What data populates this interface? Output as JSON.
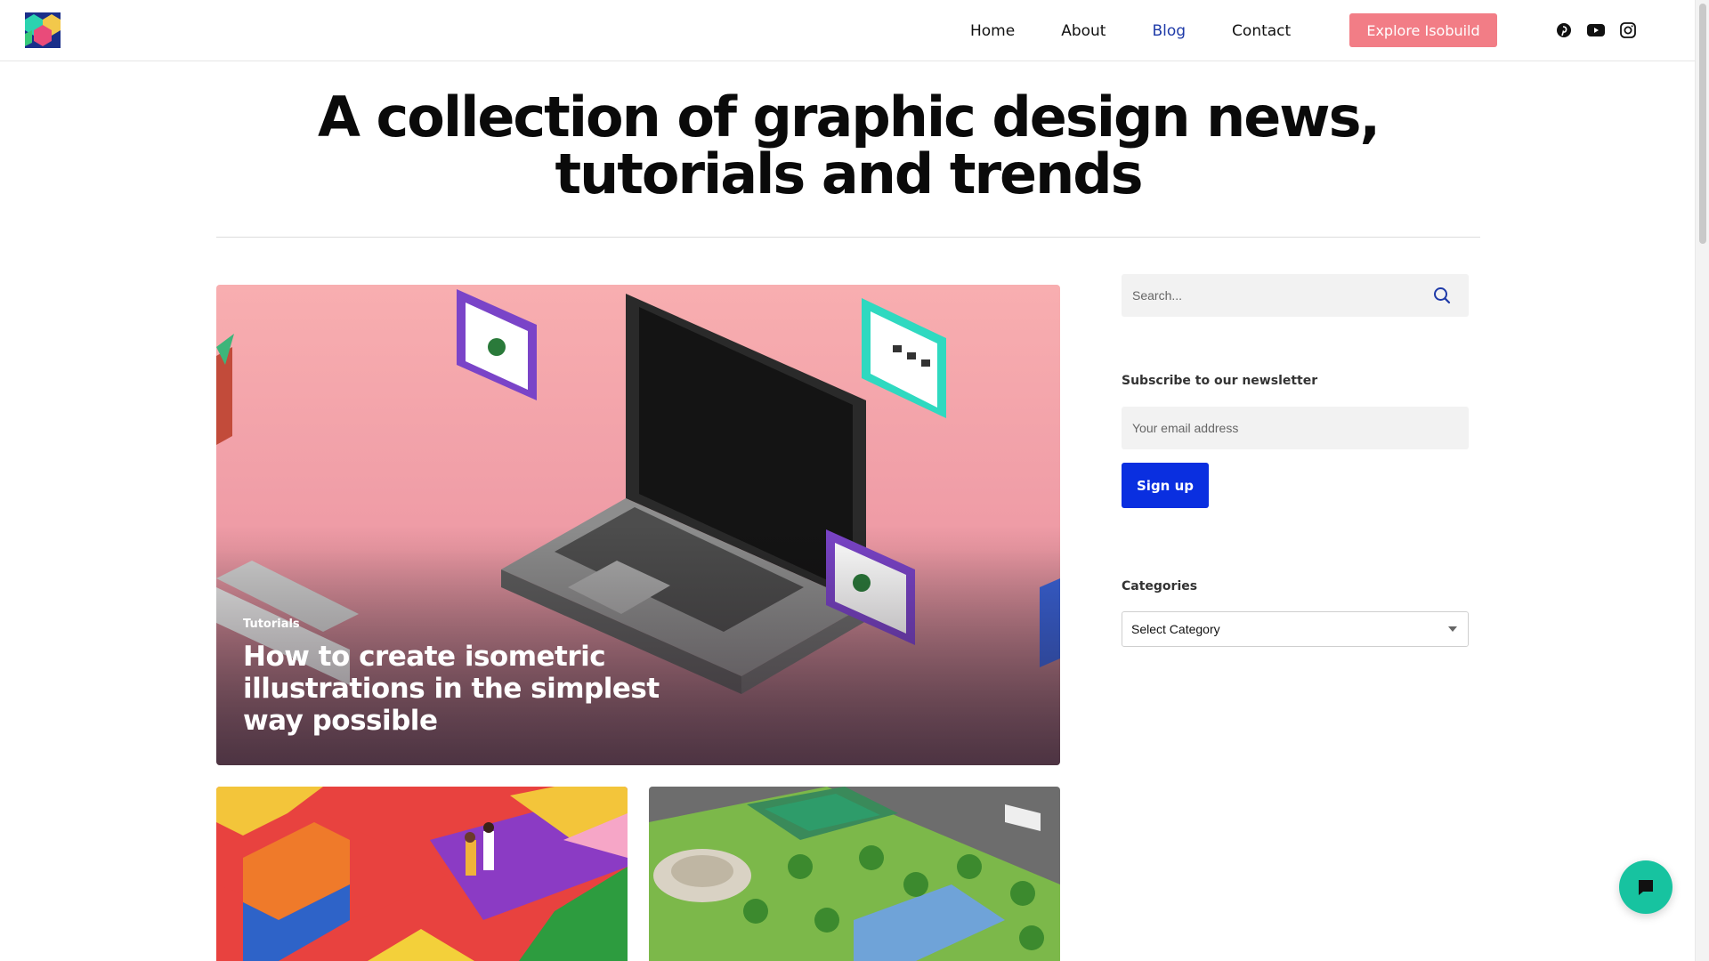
{
  "nav": {
    "items": [
      {
        "label": "Home",
        "active": false
      },
      {
        "label": "About",
        "active": false
      },
      {
        "label": "Blog",
        "active": true
      },
      {
        "label": "Contact",
        "active": false
      }
    ],
    "cta_label": "Explore Isobuild",
    "social_icons": [
      "pinterest-icon",
      "youtube-icon",
      "instagram-icon"
    ]
  },
  "page": {
    "title": "A collection of graphic design news, tutorials and trends"
  },
  "featured_post": {
    "category": "Tutorials",
    "title": "How to create isometric illustrations in the simplest way possible"
  },
  "sidebar": {
    "search_placeholder": "Search...",
    "newsletter_heading": "Subscribe to our newsletter",
    "email_placeholder": "Your email address",
    "signup_label": "Sign up",
    "categories_heading": "Categories",
    "category_select_value": "Select Category"
  },
  "colors": {
    "cta": "#f27d86",
    "active_nav": "#1e3aa8",
    "signup": "#0a2fe0",
    "chat": "#17c3a0"
  }
}
